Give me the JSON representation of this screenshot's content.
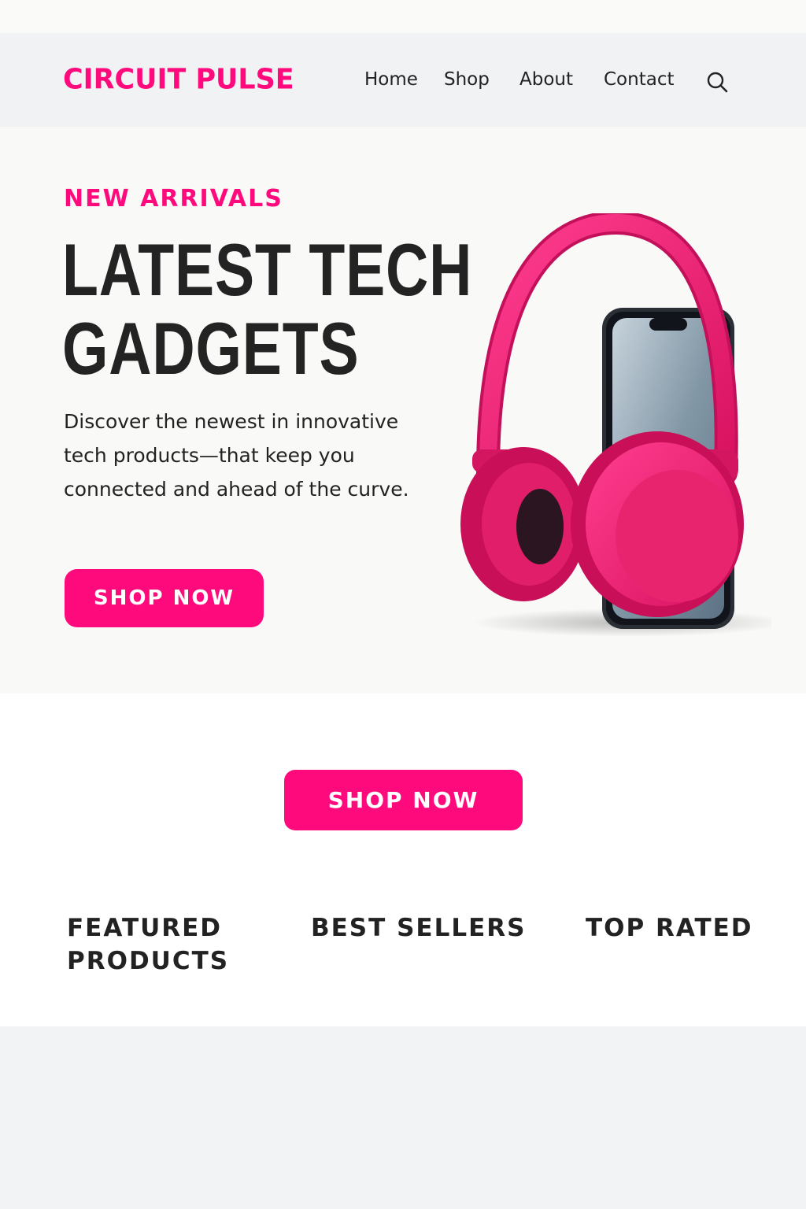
{
  "brand": {
    "name": "CIRCUIT PULSE",
    "accent": "#ff0a7d"
  },
  "nav": {
    "items": [
      "Home",
      "Shop",
      "About",
      "Contact"
    ],
    "search_icon": "search-icon"
  },
  "hero": {
    "eyebrow": "NEW ARRIVALS",
    "headline_line1": "LATEST TECH",
    "headline_line2": "GADGETS",
    "description": "Discover the newest in innovative tech products—that keep you connected and ahead of the curve.",
    "cta_label": "SHOP NOW",
    "image": "pink-headphones-on-smartphone"
  },
  "section": {
    "cta_label": "SHOP NOW",
    "categories": [
      "FEATURED PRODUCTS",
      "BEST SELLERS",
      "TOP RATED"
    ]
  }
}
